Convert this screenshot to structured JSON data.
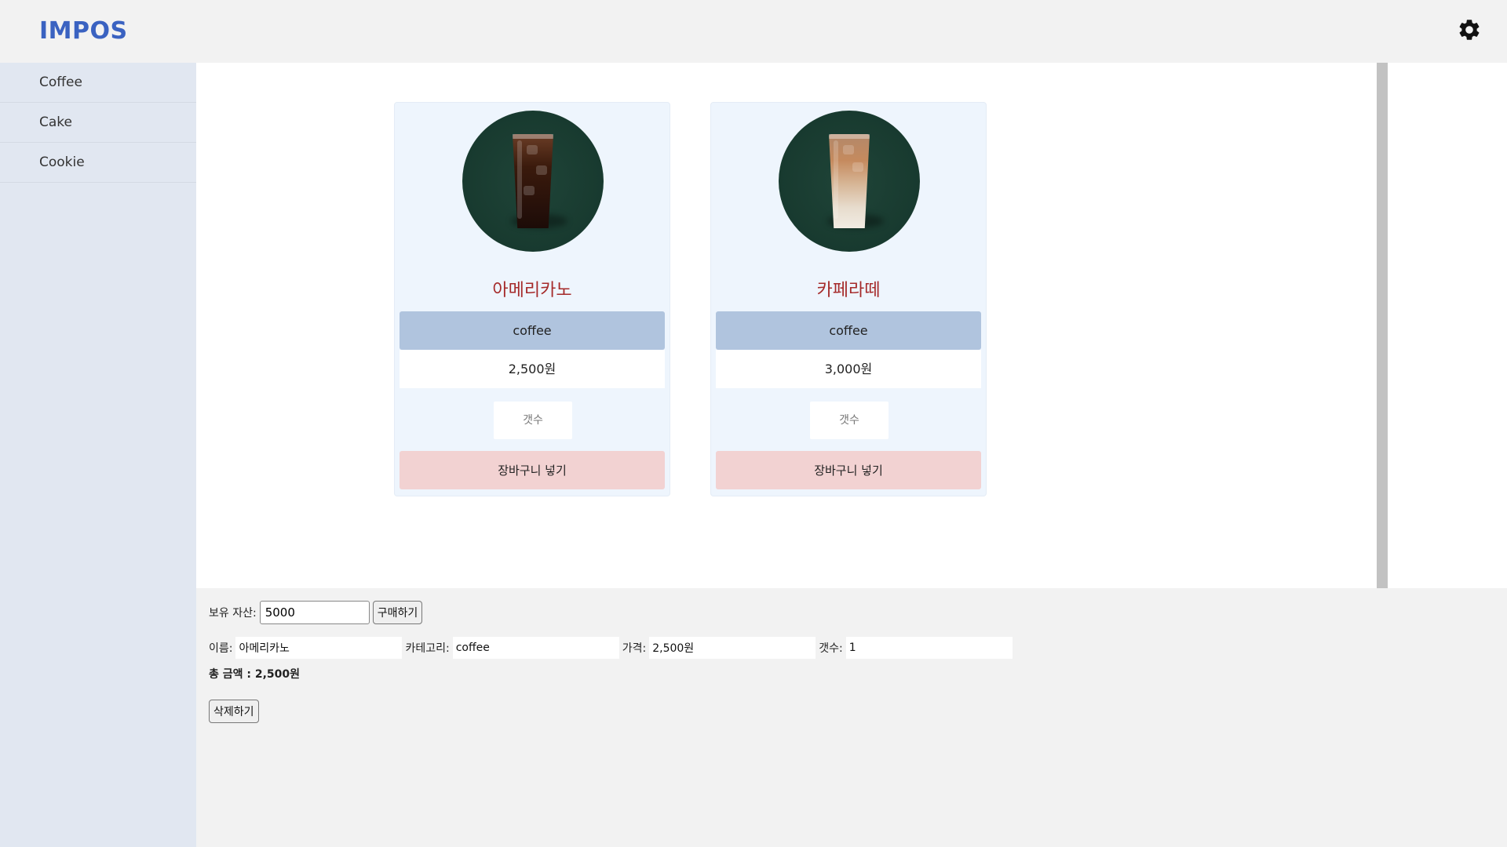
{
  "app": {
    "logo": "IMPOS"
  },
  "header": {
    "settings_icon": "gear-icon"
  },
  "sidebar": {
    "items": [
      {
        "label": "Coffee"
      },
      {
        "label": "Cake"
      },
      {
        "label": "Cookie"
      }
    ]
  },
  "products": [
    {
      "name": "아메리카노",
      "category": "coffee",
      "price": "2,500원",
      "qty_placeholder": "갯수",
      "add_label": "장바구니 넣기"
    },
    {
      "name": "카페라떼",
      "category": "coffee",
      "price": "3,000원",
      "qty_placeholder": "갯수",
      "add_label": "장바구니 넣기"
    }
  ],
  "cart": {
    "asset_label": "보유 자산:",
    "asset_value": "5000",
    "buy_label": "구매하기",
    "item": {
      "name_label": "이름:",
      "name_value": "아메리카노",
      "category_label": "카테고리:",
      "category_value": "coffee",
      "price_label": "가격:",
      "price_value": "2,500원",
      "qty_label": "갯수:",
      "qty_value": "1"
    },
    "total_text": "총 금액 : 2,500원",
    "delete_label": "삭제하기"
  },
  "colors": {
    "brand": "#3a62c1",
    "product_name": "#a52a2a",
    "category_bg": "#b0c4de",
    "add_button_bg": "#f2d2d2",
    "card_bg": "#eef5fd",
    "sidebar_bg": "#e1e7f1"
  }
}
